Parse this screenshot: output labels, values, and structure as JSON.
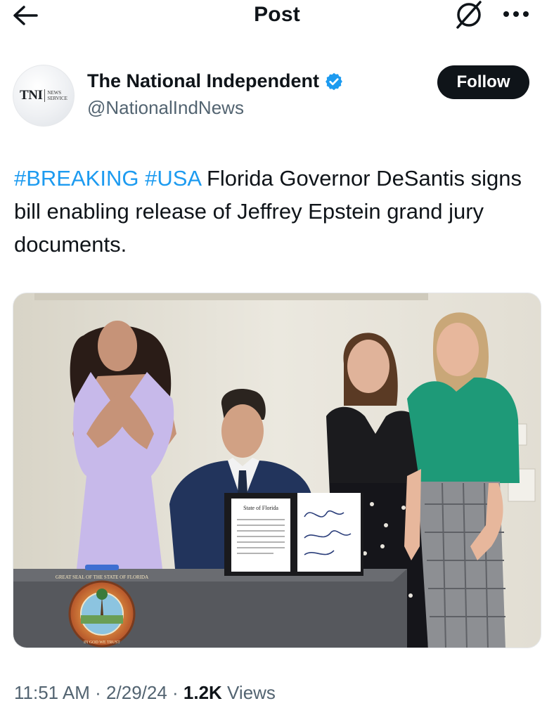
{
  "header": {
    "title": "Post",
    "back_icon": "arrow-left-icon",
    "grok_icon": "grok-icon",
    "more_icon": "more-horizontal-icon"
  },
  "author": {
    "avatar_text": "TNI",
    "avatar_subtext_line1": "NEWS",
    "avatar_subtext_line2": "SERVICE",
    "display_name": "The National Independent",
    "handle": "@NationalIndNews",
    "verified_icon": "verified-badge-icon",
    "verified_color": "#1d9bf0"
  },
  "follow": {
    "label": "Follow"
  },
  "post": {
    "hashtag1": "#BREAKING",
    "hashtag2": "#USA",
    "text": " Florida Governor DeSantis signs bill enabling release of Jeffrey Epstein grand jury documents.",
    "hashtag_color": "#1d9bf0"
  },
  "media": {
    "seal_text": "GREAT SEAL OF THE STATE OF FLORIDA",
    "seal_motto": "IN GOD WE TRUST",
    "document_title": "State of Florida"
  },
  "meta": {
    "time": "11:51 AM",
    "sep1": " · ",
    "date": "2/29/24",
    "sep2": " · ",
    "views_count": "1.2K",
    "views_label": " Views"
  }
}
